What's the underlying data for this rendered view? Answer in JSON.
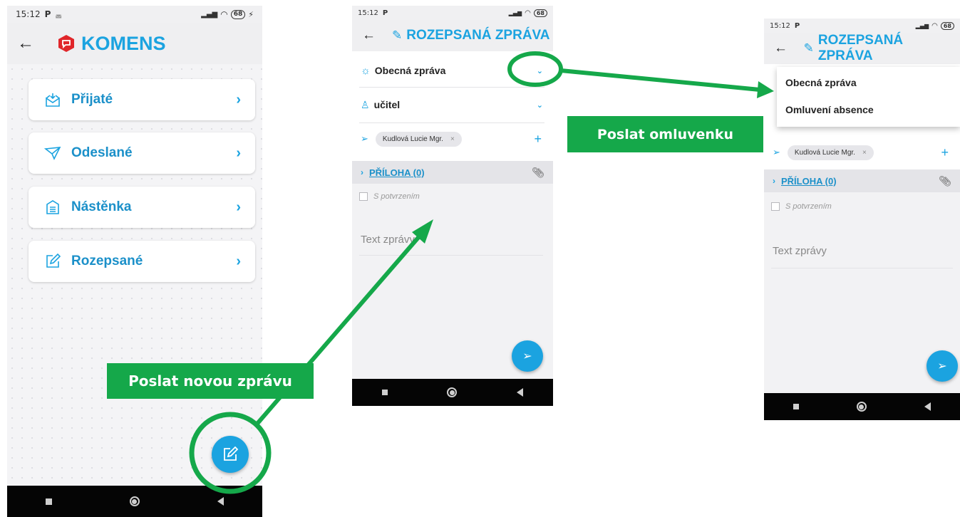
{
  "screen1": {
    "status_time": "15:12",
    "battery": "68",
    "app_title": "KOMENS",
    "menu": [
      {
        "label": "Přijaté",
        "icon": "inbox-icon"
      },
      {
        "label": "Odeslané",
        "icon": "send-icon"
      },
      {
        "label": "Nástěnka",
        "icon": "board-icon"
      },
      {
        "label": "Rozepsané",
        "icon": "edit-icon"
      }
    ],
    "chevron": "›"
  },
  "screen2": {
    "status_time": "15:12",
    "battery": "68",
    "title": "ROZEPSANÁ ZPRÁVA",
    "message_type": "Obecná zpráva",
    "recipient_type": "učitel",
    "recipient_chip": "Kudlová Lucie Mgr.",
    "attachment_label": "PŘÍLOHA (0)",
    "confirm_label": "S potvrzením",
    "message_placeholder": "Text zprávy"
  },
  "screen3": {
    "status_time": "15:12",
    "battery": "68",
    "title": "ROZEPSANÁ ZPRÁVA",
    "dropdown_options": [
      "Obecná zpráva",
      "Omluvení absence"
    ],
    "recipient_chip": "Kudlová Lucie Mgr.",
    "attachment_label": "PŘÍLOHA (0)",
    "confirm_label": "S potvrzením",
    "message_placeholder": "Text zprávy"
  },
  "callouts": {
    "new_message": "Poslat novou zprávu",
    "excuse": "Poslat omluvenku"
  },
  "colors": {
    "accent": "#1ba3e0",
    "callout": "#15a84a",
    "logo": "#e0262a"
  }
}
